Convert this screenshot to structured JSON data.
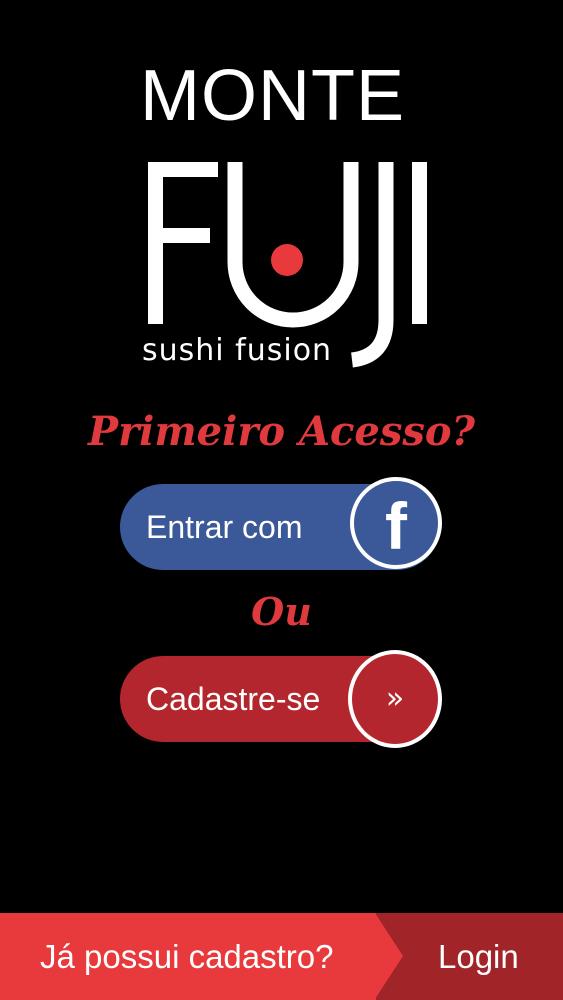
{
  "logo": {
    "line1": "MONTE",
    "line2": "FUJI",
    "tagline": "sushi fusion"
  },
  "headline": "Primeiro Acesso?",
  "facebook_button": {
    "label": "Entrar com",
    "icon": "facebook-icon",
    "icon_glyph": "f"
  },
  "separator": "Ou",
  "register_button": {
    "label": "Cadastre-se",
    "icon": "double-chevron-right-icon",
    "icon_glyph": "»"
  },
  "bottom_bar": {
    "question": "Já possui cadastro?",
    "login_label": "Login"
  },
  "colors": {
    "background": "#000000",
    "accent_red": "#e03a3e",
    "facebook_blue": "#3b5998",
    "register_red": "#b3262d",
    "bottom_bar_left": "#e8393c",
    "bottom_bar_right": "#a12428"
  }
}
